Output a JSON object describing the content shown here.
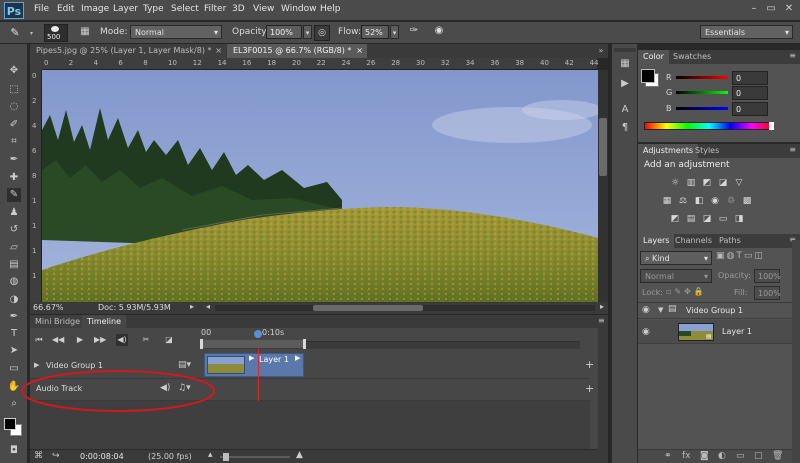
{
  "menubar": {
    "logo": "Ps",
    "items": [
      "File",
      "Edit",
      "Image",
      "Layer",
      "Type",
      "Select",
      "Filter",
      "3D",
      "View",
      "Window",
      "Help"
    ]
  },
  "options": {
    "brush_size": "500",
    "mode_label": "Mode:",
    "mode_value": "Normal",
    "opacity_label": "Opacity:",
    "opacity_value": "100%",
    "flow_label": "Flow:",
    "flow_value": "52%",
    "workspace": "Essentials"
  },
  "doc_tabs": [
    {
      "label": "Pipes5.jpg @ 25% (Layer 1, Layer Mask/8) *",
      "active": false
    },
    {
      "label": "EL3F0015 @ 66.7% (RGB/8) *",
      "active": true
    }
  ],
  "rulers": {
    "h": [
      "0",
      "2",
      "4",
      "6",
      "8",
      "10",
      "12",
      "14",
      "16",
      "18",
      "20",
      "22",
      "24",
      "26",
      "28",
      "30",
      "32",
      "34",
      "36",
      "38",
      "40",
      "42",
      "44"
    ],
    "v": [
      "0",
      "2",
      "4",
      "6",
      "8",
      "1",
      "1",
      "1",
      "1"
    ]
  },
  "status": {
    "zoom": "66.67%",
    "doc": "Doc: 5.93M/5.93M"
  },
  "timeline": {
    "tabs": [
      "Mini Bridge",
      "Timeline"
    ],
    "ruler_start": "00",
    "ruler_mark": "0:10s",
    "video_group": "Video Group 1",
    "clip_label": "Layer 1",
    "audio_track": "Audio Track",
    "time": "0:00:08:04",
    "fps": "(25.00 fps)"
  },
  "color_panel": {
    "tabs": [
      "Color",
      "Swatches"
    ],
    "r_label": "R",
    "r_value": "0",
    "g_label": "G",
    "g_value": "0",
    "b_label": "B",
    "b_value": "0"
  },
  "adjustments_panel": {
    "tabs": [
      "Adjustments",
      "Styles"
    ],
    "heading": "Add an adjustment"
  },
  "layers_panel": {
    "tabs": [
      "Layers",
      "Channels",
      "Paths"
    ],
    "filter_kind": "Kind",
    "blend_mode": "Normal",
    "opacity_label": "Opacity:",
    "opacity_value": "100%",
    "lock_label": "Lock:",
    "fill_label": "Fill:",
    "fill_value": "100%",
    "group_name": "Video Group 1",
    "layer_name": "Layer 1"
  },
  "colors": {
    "annotation": "#d11a1a",
    "accent": "#2a5caa"
  }
}
